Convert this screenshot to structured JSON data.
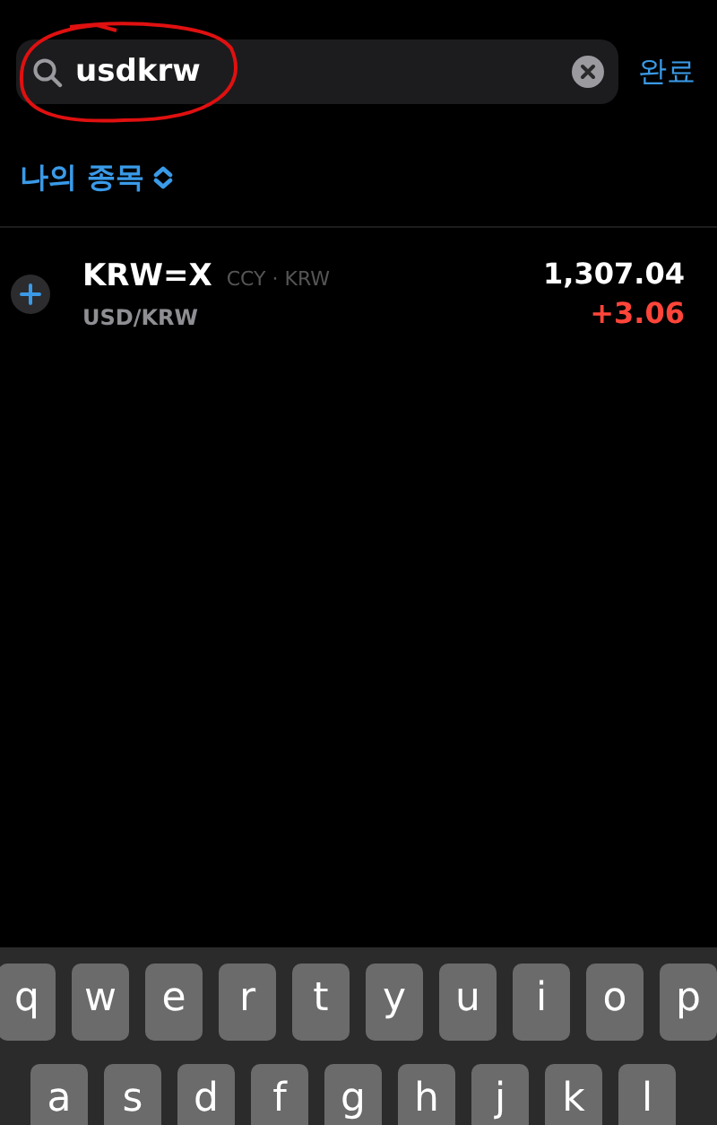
{
  "search": {
    "value": "usdkrw"
  },
  "done_button": "완료",
  "list_header": {
    "label": "나의 종목"
  },
  "quotes": [
    {
      "symbol": "KRW=X",
      "exchange": "CCY · KRW",
      "name": "USD/KRW",
      "price": "1,307.04",
      "change": "+3.06"
    }
  ],
  "keyboard": {
    "rows": [
      [
        "q",
        "w",
        "e",
        "r",
        "t",
        "y",
        "u",
        "i",
        "o",
        "p"
      ],
      [
        "a",
        "s",
        "d",
        "f",
        "g",
        "h",
        "j",
        "k",
        "l"
      ]
    ]
  }
}
